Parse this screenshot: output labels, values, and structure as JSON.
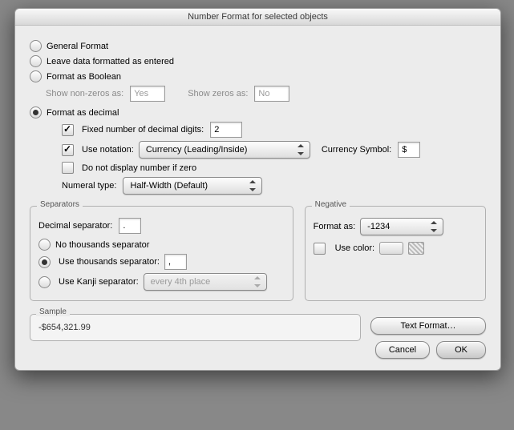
{
  "title": "Number Format for selected objects",
  "format_options": {
    "general": "General Format",
    "as_entered": "Leave data formatted as entered",
    "boolean": "Format as Boolean",
    "decimal": "Format as decimal"
  },
  "boolean": {
    "show_nonzeros_label": "Show non-zeros as:",
    "show_nonzeros_value": "Yes",
    "show_zeros_label": "Show zeros as:",
    "show_zeros_value": "No"
  },
  "decimal": {
    "fixed_digits_label": "Fixed number of decimal digits:",
    "fixed_digits_value": "2",
    "use_notation_label": "Use notation:",
    "notation_value": "Currency (Leading/Inside)",
    "currency_symbol_label": "Currency Symbol:",
    "currency_symbol_value": "$",
    "no_display_zero_label": "Do not display number if zero",
    "numeral_type_label": "Numeral type:",
    "numeral_type_value": "Half-Width (Default)"
  },
  "separators": {
    "legend": "Separators",
    "decimal_sep_label": "Decimal separator:",
    "decimal_sep_value": ".",
    "no_thousands_label": "No thousands separator",
    "use_thousands_label": "Use thousands separator:",
    "use_thousands_value": ",",
    "kanji_label": "Use Kanji separator:",
    "kanji_value": "every 4th place"
  },
  "negative": {
    "legend": "Negative",
    "format_as_label": "Format as:",
    "format_as_value": "-1234",
    "use_color_label": "Use color:"
  },
  "sample": {
    "legend": "Sample",
    "value": "-$654,321.99"
  },
  "buttons": {
    "text_format": "Text Format…",
    "cancel": "Cancel",
    "ok": "OK"
  }
}
